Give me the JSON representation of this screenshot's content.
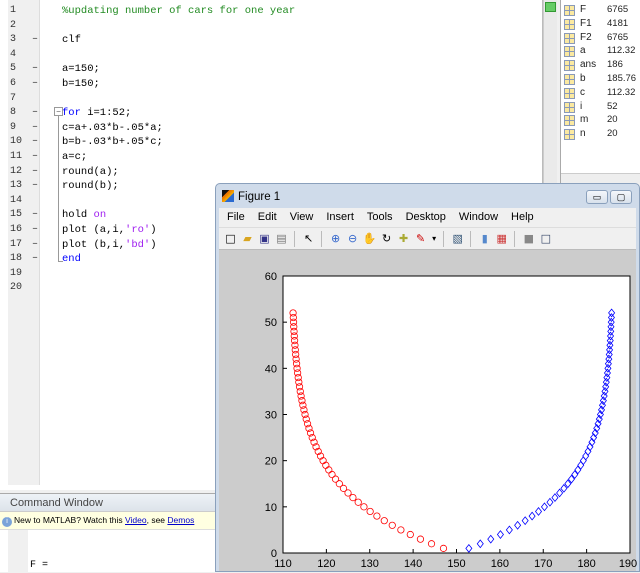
{
  "editor": {
    "lines": [
      {
        "n": "1",
        "d": false,
        "t": [
          {
            "c": "cm",
            "s": "%updating number of cars for one year"
          }
        ]
      },
      {
        "n": "2",
        "d": false,
        "t": []
      },
      {
        "n": "3",
        "d": true,
        "t": [
          {
            "c": "",
            "s": "clf"
          }
        ]
      },
      {
        "n": "4",
        "d": false,
        "t": []
      },
      {
        "n": "5",
        "d": true,
        "t": [
          {
            "c": "",
            "s": "a=150;"
          }
        ]
      },
      {
        "n": "6",
        "d": true,
        "t": [
          {
            "c": "",
            "s": "b=150;"
          }
        ]
      },
      {
        "n": "7",
        "d": false,
        "t": []
      },
      {
        "n": "8",
        "d": true,
        "t": [
          {
            "c": "kw",
            "s": "for"
          },
          {
            "c": "",
            "s": " i=1:52;"
          }
        ]
      },
      {
        "n": "9",
        "d": true,
        "t": [
          {
            "c": "",
            "s": "c=a+.03*b-.05*a;"
          }
        ]
      },
      {
        "n": "10",
        "d": true,
        "t": [
          {
            "c": "",
            "s": "b=b-.03*b+.05*c;"
          }
        ]
      },
      {
        "n": "11",
        "d": true,
        "t": [
          {
            "c": "",
            "s": "a=c;"
          }
        ]
      },
      {
        "n": "12",
        "d": true,
        "t": [
          {
            "c": "",
            "s": "round(a);"
          }
        ]
      },
      {
        "n": "13",
        "d": true,
        "t": [
          {
            "c": "",
            "s": "round(b);"
          }
        ]
      },
      {
        "n": "14",
        "d": false,
        "t": []
      },
      {
        "n": "15",
        "d": true,
        "t": [
          {
            "c": "",
            "s": "hold "
          },
          {
            "c": "st",
            "s": "on"
          }
        ]
      },
      {
        "n": "16",
        "d": true,
        "t": [
          {
            "c": "",
            "s": "plot (a,i,"
          },
          {
            "c": "st",
            "s": "'ro'"
          },
          {
            "c": "",
            "s": ")"
          }
        ]
      },
      {
        "n": "17",
        "d": true,
        "t": [
          {
            "c": "",
            "s": "plot (b,i,"
          },
          {
            "c": "st",
            "s": "'bd'"
          },
          {
            "c": "",
            "s": ")"
          }
        ]
      },
      {
        "n": "18",
        "d": true,
        "t": [
          {
            "c": "kw",
            "s": "end"
          }
        ]
      },
      {
        "n": "19",
        "d": false,
        "t": []
      },
      {
        "n": "20",
        "d": false,
        "t": []
      }
    ],
    "dash": "–"
  },
  "workspace": {
    "vars": [
      {
        "name": "F",
        "value": "6765"
      },
      {
        "name": "F1",
        "value": "4181"
      },
      {
        "name": "F2",
        "value": "6765"
      },
      {
        "name": "a",
        "value": "112.32"
      },
      {
        "name": "ans",
        "value": "186"
      },
      {
        "name": "b",
        "value": "185.76"
      },
      {
        "name": "c",
        "value": "112.32"
      },
      {
        "name": "i",
        "value": "52"
      },
      {
        "name": "m",
        "value": "20"
      },
      {
        "name": "n",
        "value": "20"
      }
    ]
  },
  "command_window": {
    "title": "Command Window",
    "info_pre": "New to MATLAB? Watch this ",
    "info_link1": "Video",
    "info_mid": ", see ",
    "info_link2": "Demos",
    "output": "F ="
  },
  "figure": {
    "title": "Figure 1",
    "menu": [
      "File",
      "Edit",
      "View",
      "Insert",
      "Tools",
      "Desktop",
      "Window",
      "Help"
    ],
    "min": "▭",
    "max": "▢"
  },
  "chart_data": {
    "type": "scatter",
    "xlim": [
      110,
      190
    ],
    "ylim": [
      0,
      60
    ],
    "xticks": [
      110,
      120,
      130,
      140,
      150,
      160,
      170,
      180,
      190
    ],
    "yticks": [
      0,
      10,
      20,
      30,
      40,
      50,
      60
    ],
    "series": [
      {
        "name": "a",
        "marker": "circle",
        "color": "#ff0000",
        "x": [
          147.0,
          144.24,
          141.69,
          139.35,
          137.18,
          135.19,
          133.35,
          131.65,
          130.09,
          128.66,
          127.34,
          126.12,
          124.99,
          123.95,
          122.99,
          122.11,
          121.3,
          120.56,
          119.87,
          119.24,
          118.66,
          118.12,
          117.62,
          117.16,
          116.74,
          116.35,
          115.99,
          115.66,
          115.36,
          115.08,
          114.83,
          114.59,
          114.37,
          114.17,
          113.98,
          113.81,
          113.65,
          113.51,
          113.37,
          113.24,
          113.13,
          113.02,
          112.92,
          112.83,
          112.75,
          112.67,
          112.6,
          112.54,
          112.48,
          112.43,
          112.38,
          112.32
        ]
      },
      {
        "name": "b",
        "marker": "diamond",
        "color": "#0000ff",
        "x": [
          152.85,
          155.48,
          157.9,
          160.13,
          162.19,
          164.09,
          165.83,
          167.43,
          168.91,
          170.28,
          171.54,
          172.7,
          173.77,
          174.76,
          175.67,
          176.5,
          177.27,
          177.98,
          178.64,
          179.24,
          179.79,
          180.31,
          180.78,
          181.22,
          181.61,
          181.99,
          182.33,
          182.64,
          182.92,
          183.18,
          183.43,
          183.65,
          183.86,
          184.05,
          184.23,
          184.39,
          184.54,
          184.67,
          184.8,
          184.91,
          185.02,
          185.12,
          185.21,
          185.29,
          185.37,
          185.45,
          185.51,
          185.57,
          185.62,
          185.67,
          185.72,
          185.76
        ]
      }
    ],
    "y_from": 1
  }
}
